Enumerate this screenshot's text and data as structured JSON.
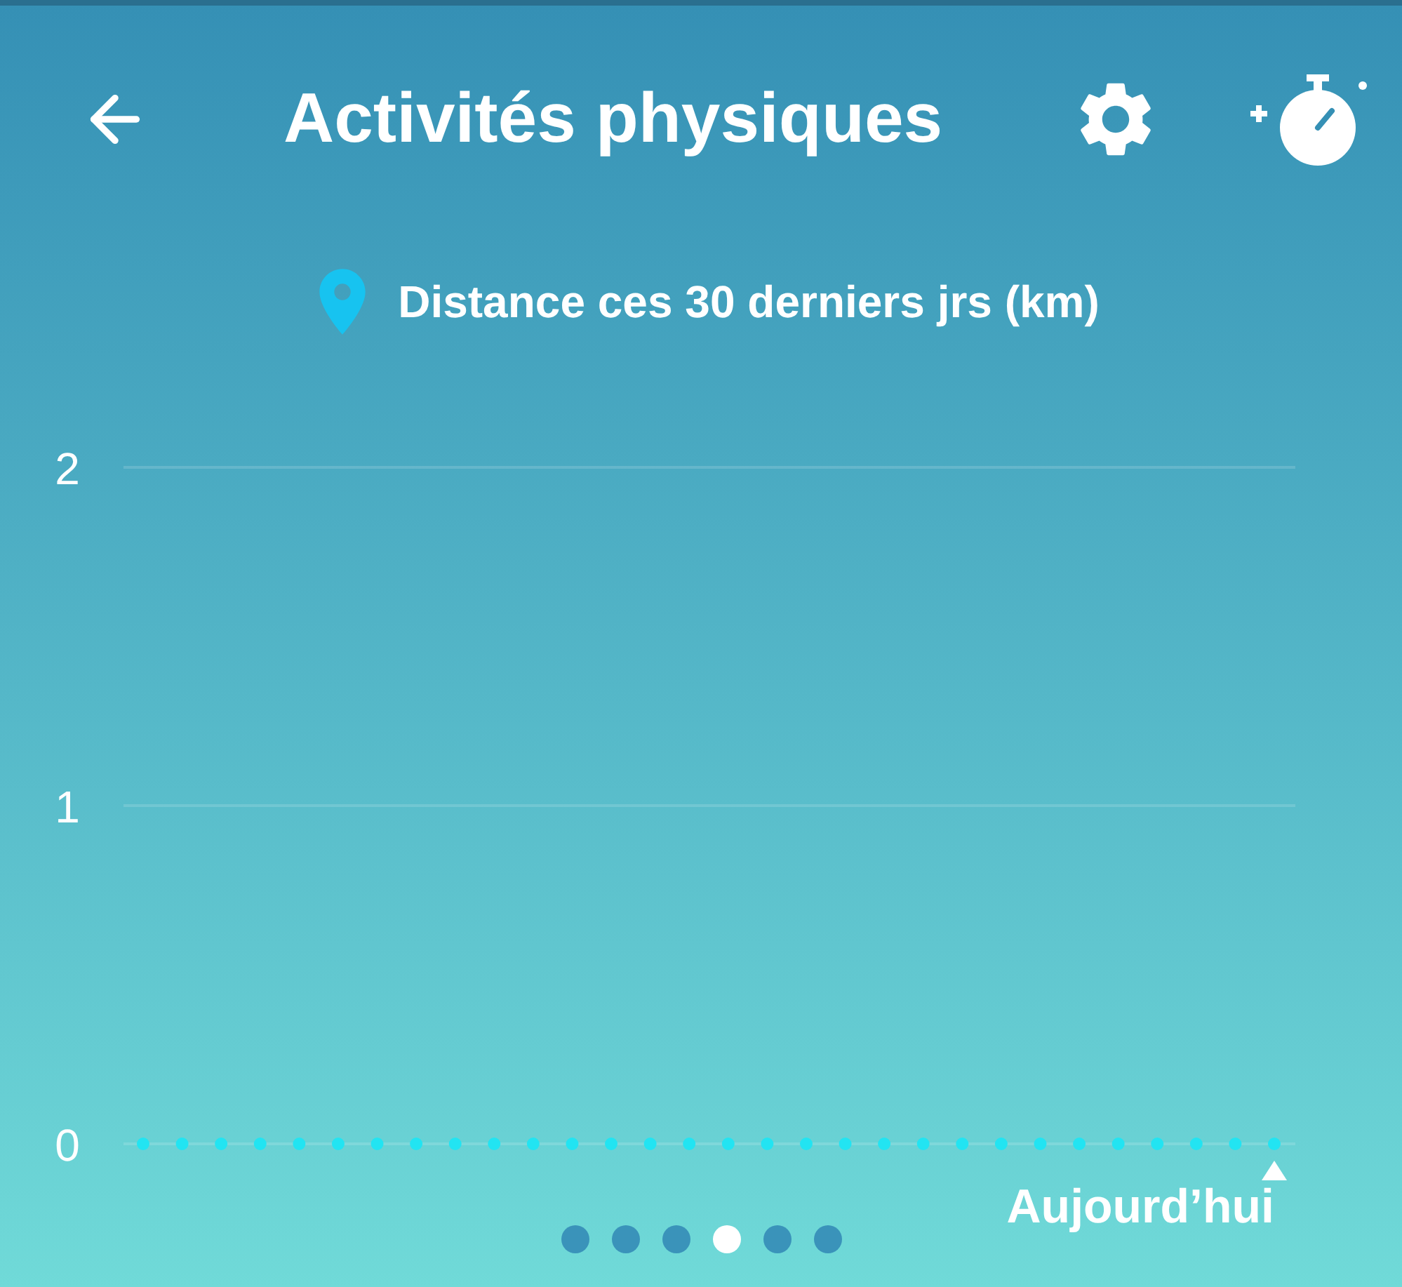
{
  "header": {
    "title": "Activités physiques"
  },
  "chart": {
    "subtitle": "Distance ces 30 derniers jrs (km)",
    "chart_data": {
      "type": "scatter",
      "values": [
        0,
        0,
        0,
        0,
        0,
        0,
        0,
        0,
        0,
        0,
        0,
        0,
        0,
        0,
        0,
        0,
        0,
        0,
        0,
        0,
        0,
        0,
        0,
        0,
        0,
        0,
        0,
        0,
        0,
        0
      ],
      "ylim": [
        0,
        2
      ],
      "yticks": [
        0,
        1,
        2
      ],
      "annotations": [
        "Aujourd’hui"
      ]
    }
  },
  "pager": [
    {
      "selected": false
    },
    {
      "selected": false
    },
    {
      "selected": false
    },
    {
      "selected": true
    },
    {
      "selected": false
    },
    {
      "selected": false
    }
  ]
}
